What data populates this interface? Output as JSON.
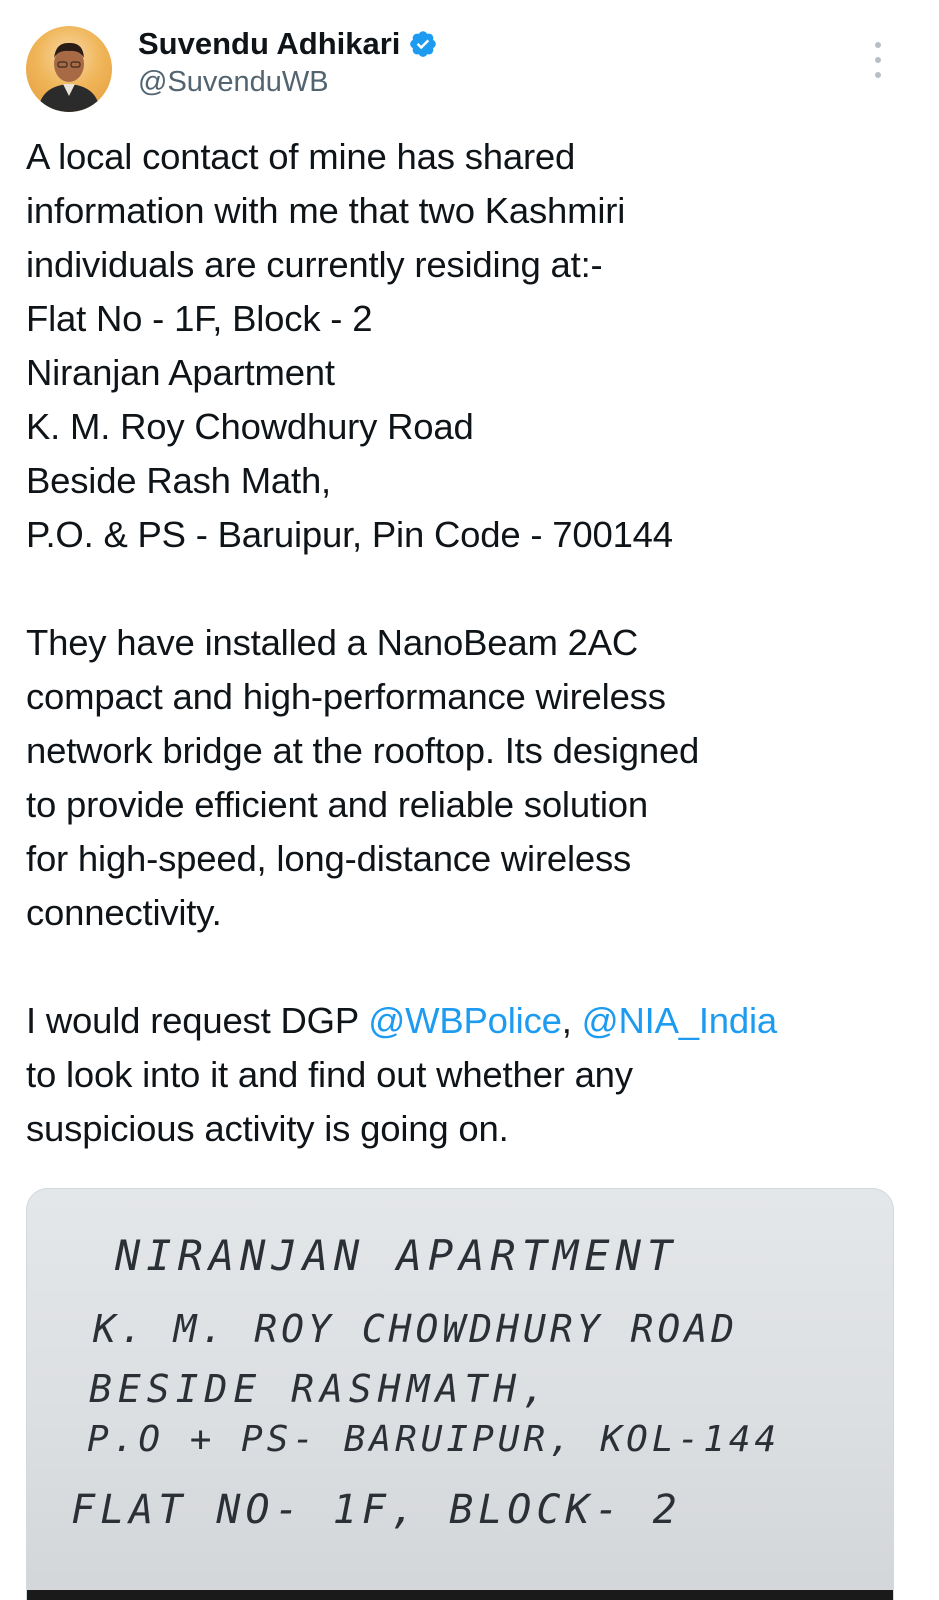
{
  "author": {
    "name": "Suvendu Adhikari",
    "handle": "@SuvenduWB",
    "verified": true
  },
  "tweet": {
    "lines": [
      "A local contact of mine has shared",
      "information with me that two Kashmiri",
      "individuals are currently residing at:-",
      "Flat No - 1F, Block - 2",
      "Niranjan Apartment",
      "K. M. Roy Chowdhury Road",
      "Beside Rash Math,",
      "P.O. & PS - Baruipur, Pin Code - 700144",
      "",
      "They have installed a NanoBeam 2AC",
      "compact and high-performance wireless",
      "network bridge at the rooftop. Its designed",
      "to provide efficient and reliable solution",
      "for high-speed, long-distance wireless",
      "connectivity.",
      "",
      "",
      "to look into it and find out whether any",
      "suspicious activity is going on."
    ],
    "request_prefix": "I would request DGP ",
    "mention_1": "@WBPolice",
    "separator": ", ",
    "mention_2": "@NIA_India"
  },
  "media": {
    "handwritten_lines": [
      "NIRANJAN APARTMENT",
      "K. M. ROY CHOWDHURY ROAD",
      "BESIDE RASHMATH,",
      "P.O + PS-  BARUIPUR, KOL-144",
      "FLAT NO-  1F,  BLOCK- 2"
    ]
  },
  "colors": {
    "text": "#0f1419",
    "secondary": "#536471",
    "link": "#1d9bf0",
    "verified": "#1d9bf0"
  },
  "icons": {
    "verified": "verified-badge-icon",
    "more": "more-vertical-icon"
  }
}
